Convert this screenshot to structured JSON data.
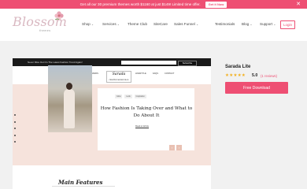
{
  "promo": {
    "text": "Get all our 30 premium themes worth $1160 at just $149! Limited time offer.",
    "cta": "Get it Now",
    "close_icon": "close-icon"
  },
  "logo": {
    "word": "Blossom",
    "sub": "themes",
    "icon": "flower-icon"
  },
  "menu": {
    "items": [
      "Shop",
      "Services",
      "Theme Club",
      "SiteCare",
      "Sales Funnel",
      "Testimonials",
      "Blog",
      "Support"
    ],
    "login": "Login",
    "chevron_icon": "chevron-down-icon"
  },
  "preview": {
    "topbar_text": "Never Miss Out On The Latest Fashion Trend Again!",
    "subscribe_label": "Subscribe",
    "menu_left": [
      "ABOUT",
      "SHOP",
      "BRANDS"
    ],
    "menu_right": [
      "LIFESTYLE",
      "FAQS",
      "CONTACT"
    ],
    "site_logo": "Sarada",
    "site_tagline": "CREATIVE FASHION BLOG",
    "tags": [
      "Glow",
      "Look",
      "Inspiration"
    ],
    "hero_title": "How Fashion Is Taking Over and What to Do About It",
    "read_more": "Read an Article",
    "section_title": "Main Features"
  },
  "product": {
    "name": "Sarada Lite",
    "stars_icon": "star-icon",
    "rating": "5.0",
    "reviews": "(1 reviews)",
    "download_label": "Free Download"
  },
  "colors": {
    "accent": "#ee4f73",
    "hero_bg": "#f6e3dc",
    "star": "#f2b01e"
  }
}
